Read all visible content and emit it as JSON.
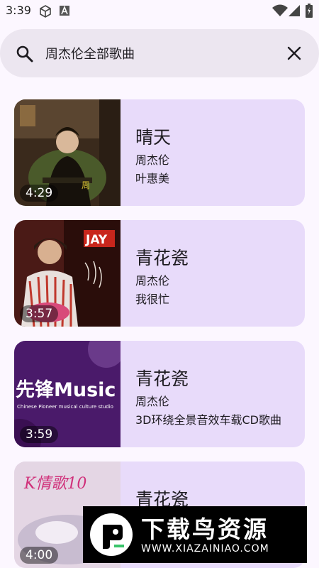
{
  "status_bar": {
    "time": "3:39",
    "icons": [
      "cube-icon",
      "a-box-icon",
      "wifi-icon",
      "signal-icon",
      "battery-icon"
    ]
  },
  "search": {
    "query": "周杰伦全部歌曲"
  },
  "songs": [
    {
      "title": "晴天",
      "artist": "周杰伦",
      "album": "叶惠美",
      "duration": "4:29"
    },
    {
      "title": "青花瓷",
      "artist": "周杰伦",
      "album": "我很忙",
      "duration": "3:57",
      "cover_text": "JAY"
    },
    {
      "title": "青花瓷",
      "artist": "周杰伦",
      "album": "3D环绕全景音效车载CD歌曲",
      "duration": "3:59",
      "cover_text": "先锋Music",
      "cover_subtext": "Chinese Pioneer musical culture studio"
    },
    {
      "title": "青花瓷",
      "artist": "",
      "album": "",
      "duration": "4:00",
      "cover_text": "K情歌10"
    }
  ],
  "watermark": {
    "title": "下载鸟资源",
    "url": "WWW.XIAZAINIAO.COM"
  },
  "colors": {
    "background": "#fcf7ff",
    "search_bg": "#ece6f0",
    "card_bg": "#e8dbfa"
  }
}
